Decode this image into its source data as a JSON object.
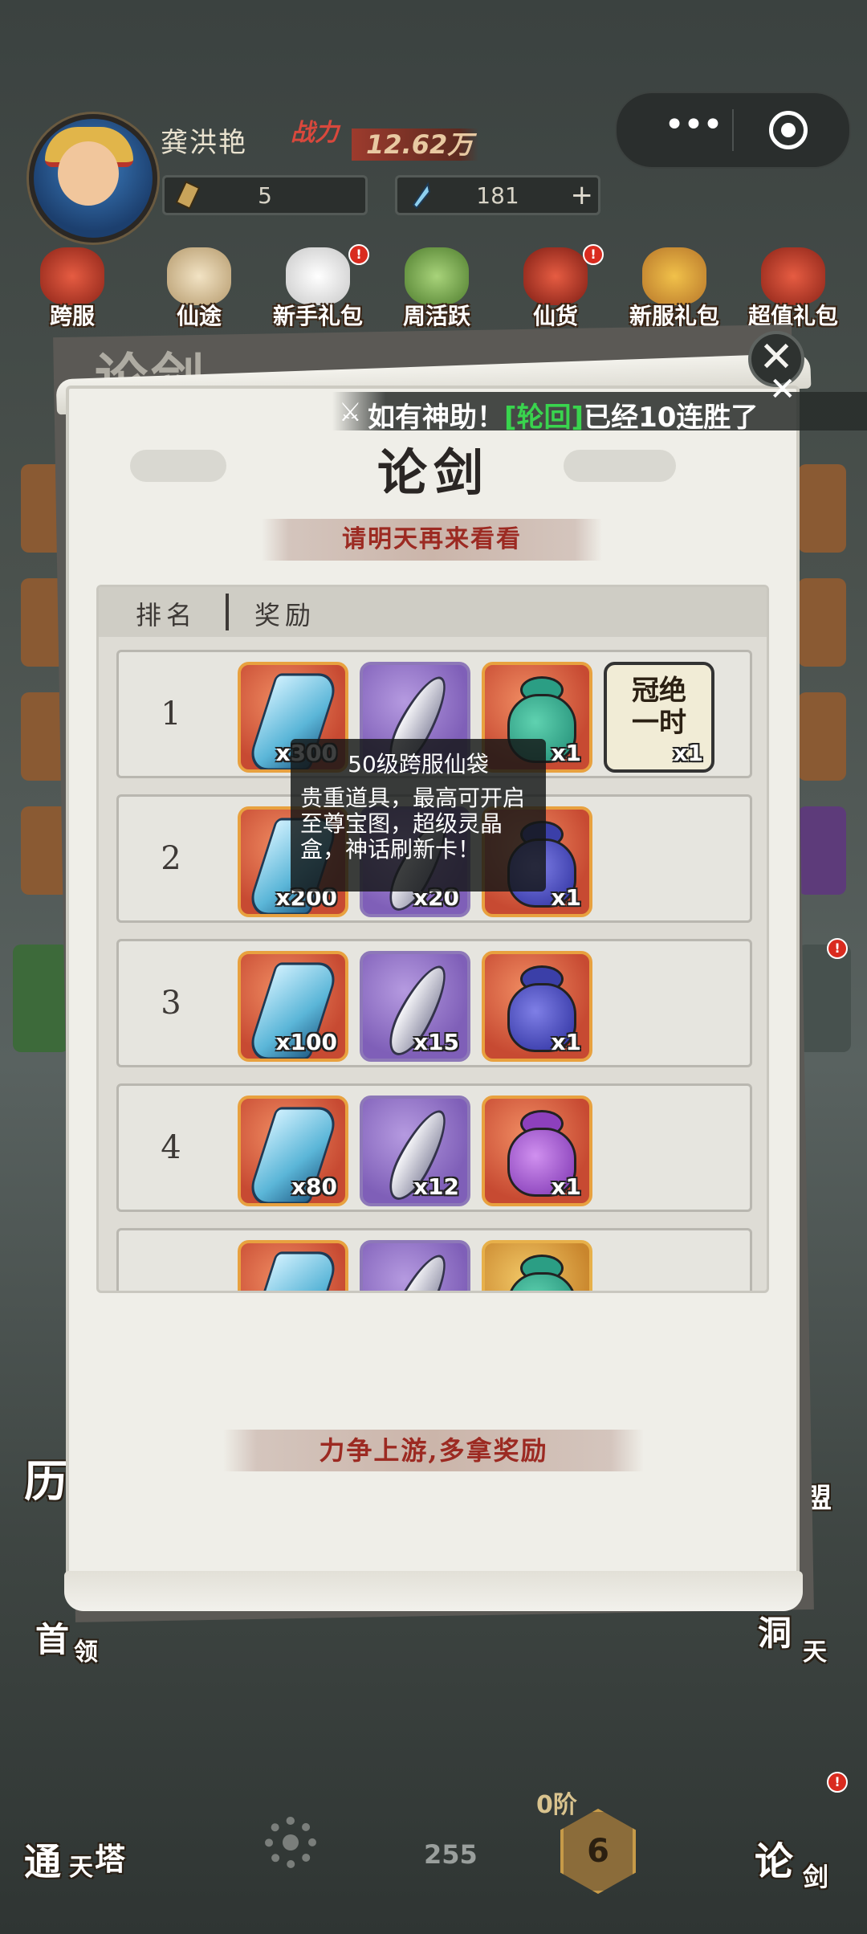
{
  "player": {
    "name": "龚洪艳",
    "power_label": "战力",
    "power_value": "12.62万",
    "resource_1": "5",
    "resource_2": "181"
  },
  "top_icons": [
    {
      "label": "跨服"
    },
    {
      "label": "仙途"
    },
    {
      "label": "新手礼包"
    },
    {
      "label": "周活跃"
    },
    {
      "label": "仙货"
    },
    {
      "label": "新服礼包"
    },
    {
      "label": "超值礼包"
    }
  ],
  "background": {
    "title": "论剑",
    "left_labels": [
      "历",
      "首",
      "领",
      "通",
      "天",
      "塔"
    ],
    "right_labels": [
      "盟",
      "洞",
      "天",
      "论",
      "剑"
    ]
  },
  "ticker": {
    "prefix": "如有神助！",
    "tag": "[轮回]",
    "suffix": "已经10连胜了"
  },
  "panel": {
    "title": "论剑",
    "banner_top": "请明天再来看看",
    "banner_bottom": "力争上游,多拿奖励",
    "close": "✕"
  },
  "table": {
    "col_rank": "排名",
    "col_reward": "奖励",
    "rows": [
      {
        "rank": "1",
        "items": [
          {
            "name": "crystal",
            "qty": "x300"
          },
          {
            "name": "feather",
            "qty": ""
          },
          {
            "name": "teal-bag",
            "qty": "x1"
          },
          {
            "name": "title-badge",
            "text_top": "冠绝",
            "text_bottom": "一时",
            "qty": "x1"
          }
        ]
      },
      {
        "rank": "2",
        "items": [
          {
            "name": "crystal",
            "qty": "x200"
          },
          {
            "name": "feather",
            "qty": "x20"
          },
          {
            "name": "blue-bag",
            "qty": "x1"
          }
        ]
      },
      {
        "rank": "3",
        "items": [
          {
            "name": "crystal",
            "qty": "x100"
          },
          {
            "name": "feather",
            "qty": "x15"
          },
          {
            "name": "blue-bag",
            "qty": "x1"
          }
        ]
      },
      {
        "rank": "4",
        "items": [
          {
            "name": "crystal",
            "qty": "x80"
          },
          {
            "name": "feather",
            "qty": "x12"
          },
          {
            "name": "violet-bag",
            "qty": "x1"
          }
        ]
      },
      {
        "rank": "",
        "items": [
          {
            "name": "crystal",
            "qty": ""
          },
          {
            "name": "feather",
            "qty": ""
          },
          {
            "name": "gold-bag",
            "qty": ""
          }
        ]
      }
    ]
  },
  "tooltip": {
    "title": "50级跨服仙袋",
    "description": "贵重道具，最高可开启至尊宝图，超级灵晶盒，神话刷新卡！"
  },
  "bottom": {
    "tier_label": "0阶",
    "tier_value": "6",
    "count": "255"
  },
  "colors": {
    "accent_red": "#9c2a22",
    "ticker_green": "#39d44e",
    "scroll_bg": "#efeee8"
  }
}
